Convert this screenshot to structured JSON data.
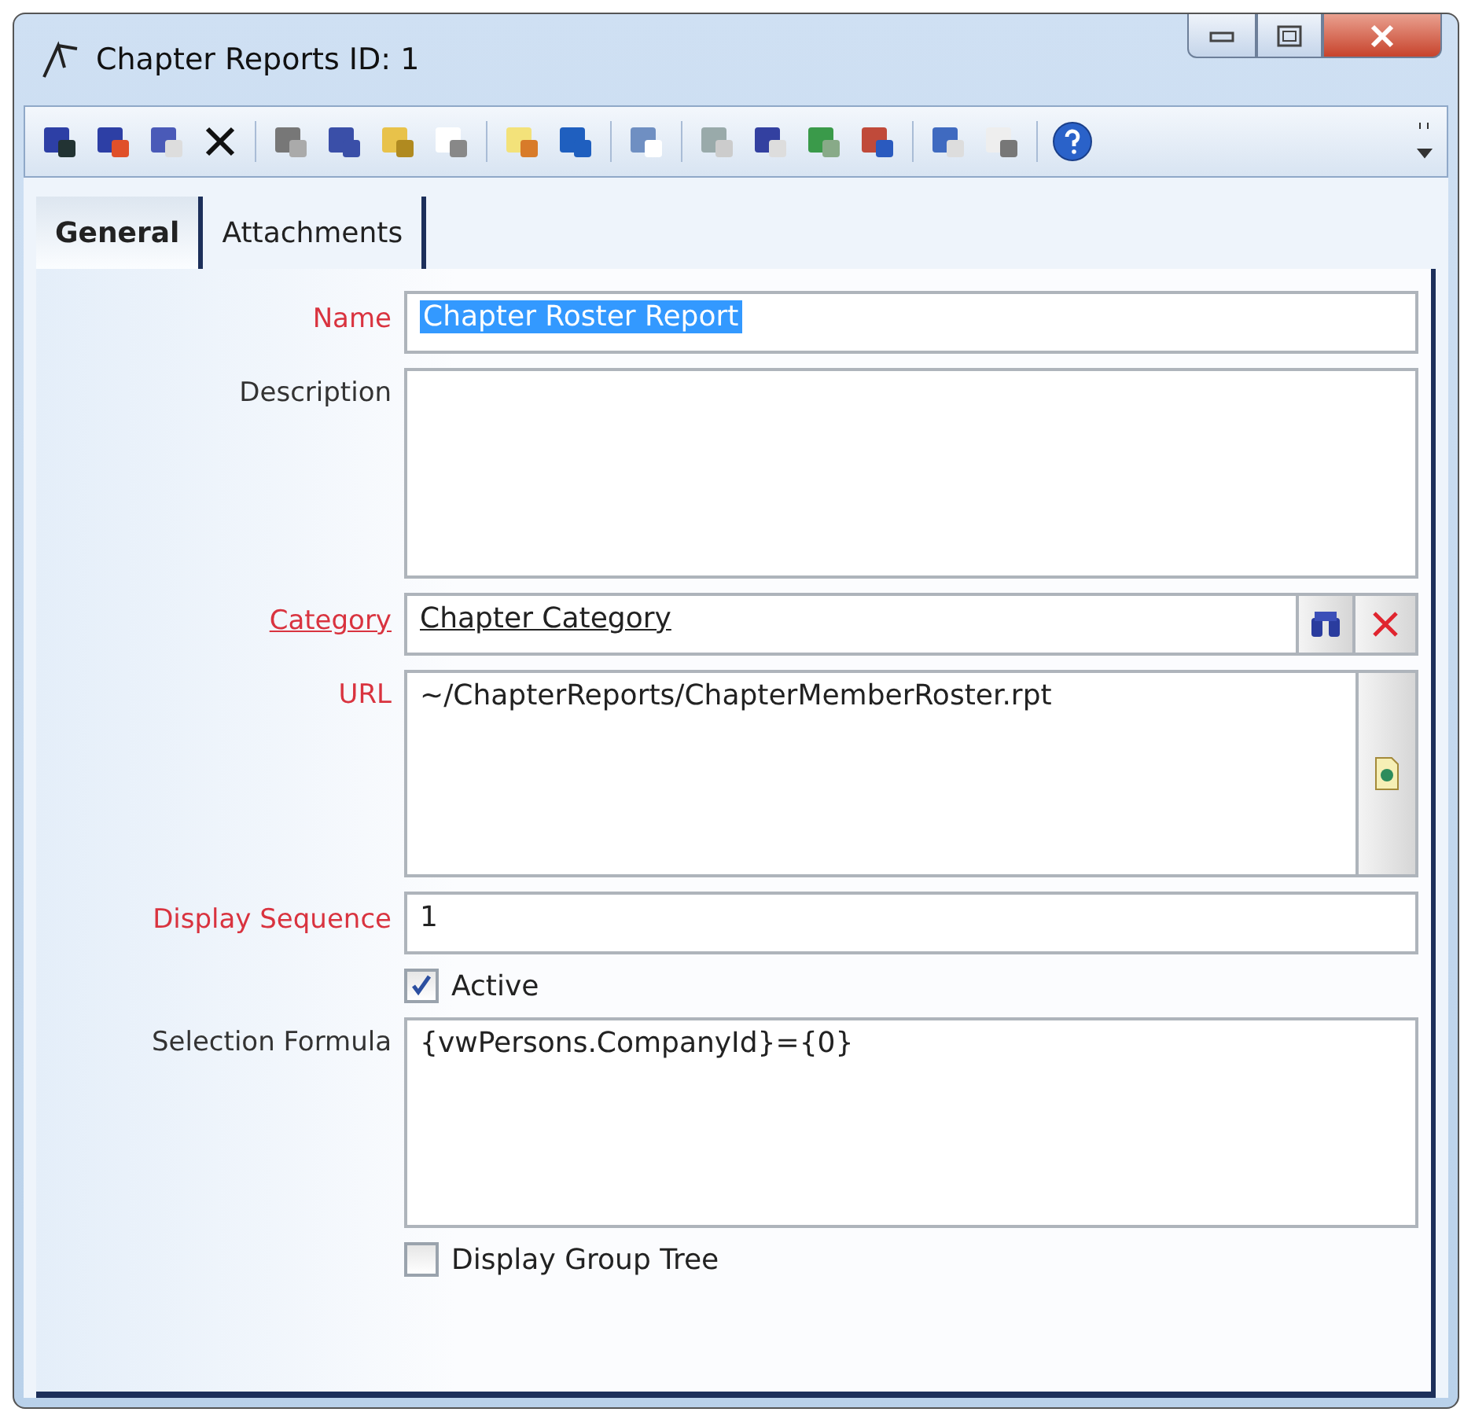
{
  "window": {
    "title": "Chapter Reports ID: 1"
  },
  "tabs": [
    {
      "label": "General",
      "selected": true
    },
    {
      "label": "Attachments",
      "selected": false
    }
  ],
  "fields": [
    {
      "kind": "text",
      "label": "Name",
      "required": true,
      "link": false,
      "value": "Chapter Roster Report",
      "highlighted": true
    },
    {
      "kind": "textarea",
      "label": "Description",
      "required": false,
      "link": false
    },
    {
      "kind": "lookup",
      "label": "Category",
      "required": true,
      "link": true,
      "value": "Chapter Category"
    },
    {
      "kind": "url",
      "label": "URL",
      "required": true,
      "link": false,
      "value": "~/ChapterReports/ChapterMemberRoster.rpt"
    },
    {
      "kind": "text",
      "label": "Display Sequence",
      "required": true,
      "link": false,
      "value": "1",
      "highlighted": false
    },
    {
      "kind": "checkbox",
      "label": "Active",
      "checked": true
    },
    {
      "kind": "textarea",
      "label": "Selection Formula",
      "required": false,
      "link": false,
      "value": "{vwPersons.CompanyId}={0}"
    },
    {
      "kind": "checkbox",
      "label": "Display Group Tree",
      "checked": false
    }
  ]
}
